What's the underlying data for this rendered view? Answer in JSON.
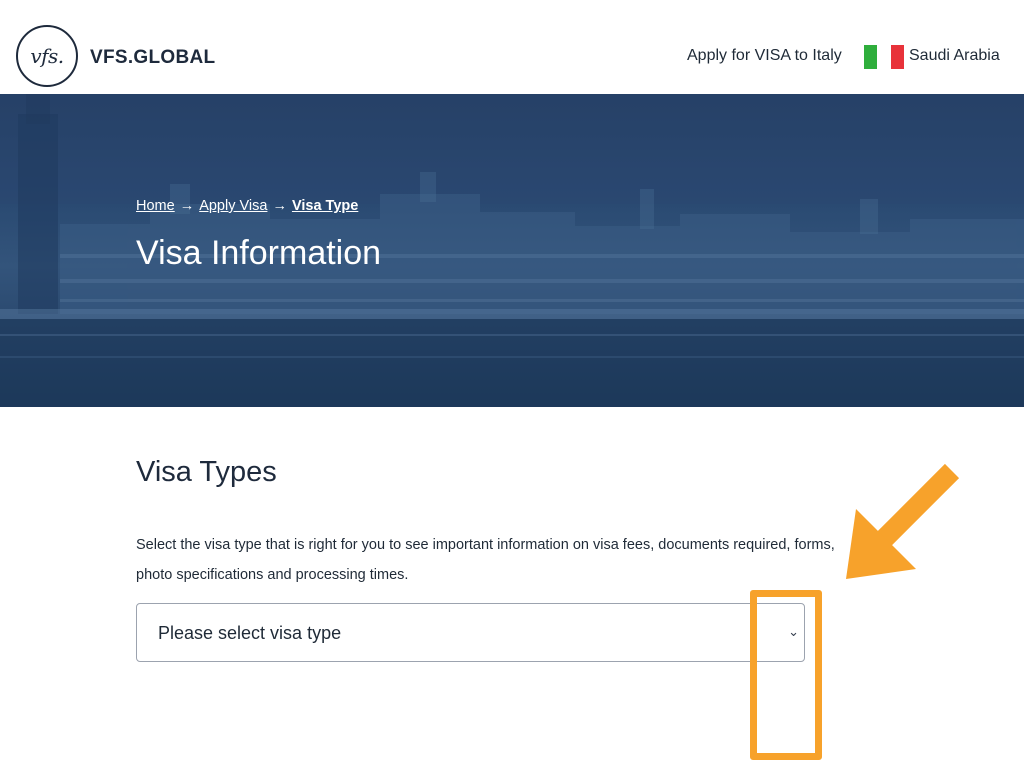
{
  "header": {
    "logo_text": "vfs.",
    "brand": "VFS.GLOBAL",
    "apply_text": "Apply for VISA to Italy",
    "country": "Saudi Arabia",
    "flag_colors": [
      "#2fae3c",
      "#ffffff",
      "#e8323a"
    ]
  },
  "breadcrumb": {
    "home": "Home",
    "apply_visa": "Apply Visa",
    "visa_type": "Visa Type",
    "separator": "→"
  },
  "hero": {
    "title": "Visa Information"
  },
  "visa_types": {
    "title": "Visa Types",
    "description": "Select the visa type that is right for you to see important information on visa fees, documents required, forms, photo specifications and processing times.",
    "select_placeholder": "Please select visa type"
  },
  "colors": {
    "hero_bg": "#2a4a72",
    "annotation": "#f7a22b",
    "text": "#1f2a37"
  }
}
